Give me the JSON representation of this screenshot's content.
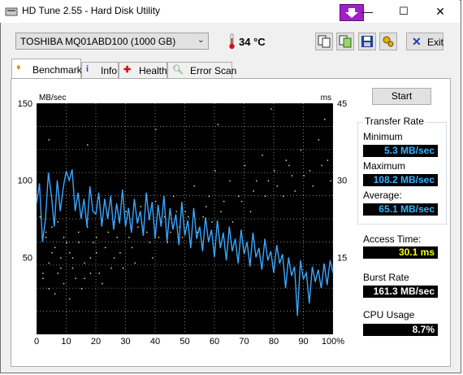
{
  "window": {
    "title": "HD Tune 2.55 - Hard Disk Utility",
    "controls": {
      "minimize": "—",
      "maximize": "☐",
      "close": "✕"
    }
  },
  "toolbar": {
    "drive": "TOSHIBA MQ01ABD100 (1000 GB)",
    "temperature": "34 °C",
    "exit_label": "Exit",
    "icons": [
      "copy-icon",
      "copy-info-icon",
      "save-icon",
      "options-icon"
    ]
  },
  "tabs": [
    {
      "label": "Benchmark",
      "icon": "benchmark-icon",
      "active": true
    },
    {
      "label": "Info",
      "icon": "info-icon",
      "active": false
    },
    {
      "label": "Health",
      "icon": "health-icon",
      "active": false
    },
    {
      "label": "Error Scan",
      "icon": "magnifier-icon",
      "active": false
    }
  ],
  "benchmark": {
    "start_label": "Start",
    "transfer_rate": {
      "group_label": "Transfer Rate",
      "minimum_label": "Minimum",
      "minimum": "5.3 MB/sec",
      "maximum_label": "Maximum",
      "maximum": "108.2 MB/sec",
      "average_label": "Average:",
      "average": "65.1 MB/sec"
    },
    "access_time_label": "Access Time:",
    "access_time": "30.1 ms",
    "burst_rate_label": "Burst Rate",
    "burst_rate": "161.3 MB/sec",
    "cpu_usage_label": "CPU Usage",
    "cpu_usage": "8.7%"
  },
  "colors": {
    "chart_bg": "#000000",
    "transfer_line": "#3aa7ff",
    "access_dots": "#ffff66",
    "grid": "#b0b0b0"
  },
  "chart_data": {
    "type": "line",
    "left_axis_unit": "MB/sec",
    "right_axis_unit": "ms",
    "left_ticks": [
      "150",
      "100",
      "50"
    ],
    "right_ticks": [
      "45",
      "30",
      "15"
    ],
    "x_ticks": [
      "0",
      "10",
      "20",
      "30",
      "40",
      "50",
      "60",
      "70",
      "80",
      "90",
      "100%"
    ],
    "xlim": [
      0,
      100
    ],
    "ylim": [
      0,
      150
    ],
    "y2lim": [
      0,
      45
    ],
    "grid": true,
    "series": [
      {
        "x": [
          0,
          1,
          2,
          3,
          4,
          5,
          6,
          7,
          8,
          9,
          10,
          11,
          12,
          13,
          14,
          15,
          16,
          17,
          18,
          19,
          20,
          21,
          22,
          23,
          24,
          25,
          26,
          27,
          28,
          29,
          30,
          31,
          32,
          33,
          34,
          35,
          36,
          37,
          38,
          39,
          40,
          41,
          42,
          43,
          44,
          45,
          46,
          47,
          48,
          49,
          50,
          51,
          52,
          53,
          54,
          55,
          56,
          57,
          58,
          59,
          60,
          61,
          62,
          63,
          64,
          65,
          66,
          67,
          68,
          69,
          70,
          71,
          72,
          73,
          74,
          75,
          76,
          77,
          78,
          79,
          80,
          81,
          82,
          83,
          84,
          85,
          86,
          87,
          88,
          89,
          90,
          91,
          92,
          93,
          94,
          95,
          96,
          97,
          98,
          99,
          100
        ],
        "values": [
          85,
          98,
          60,
          75,
          105,
          90,
          70,
          100,
          80,
          95,
          106,
          100,
          107,
          80,
          92,
          75,
          88,
          70,
          96,
          80,
          78,
          92,
          70,
          88,
          75,
          90,
          68,
          85,
          72,
          94,
          70,
          82,
          66,
          88,
          72,
          80,
          64,
          92,
          74,
          86,
          62,
          84,
          70,
          90,
          60,
          82,
          68,
          78,
          58,
          86,
          64,
          74,
          56,
          82,
          62,
          70,
          54,
          76,
          60,
          68,
          50,
          74,
          56,
          66,
          48,
          70,
          54,
          62,
          46,
          68,
          52,
          60,
          44,
          66,
          50,
          56,
          42,
          62,
          48,
          54,
          40,
          58,
          46,
          52,
          30,
          50,
          38,
          44,
          12,
          48,
          36,
          40,
          20,
          44,
          34,
          42,
          30,
          46,
          32,
          48,
          40
        ]
      }
    ],
    "access_time_series": {
      "note_units": "ms",
      "points": [
        [
          2,
          12
        ],
        [
          3,
          20
        ],
        [
          4,
          9
        ],
        [
          5,
          16
        ],
        [
          6,
          8
        ],
        [
          7,
          22
        ],
        [
          8,
          13
        ],
        [
          9,
          10
        ],
        [
          10,
          18
        ],
        [
          11,
          7
        ],
        [
          12,
          15
        ],
        [
          13,
          11
        ],
        [
          14,
          20
        ],
        [
          15,
          9
        ],
        [
          16,
          14
        ],
        [
          18,
          12
        ],
        [
          19,
          18
        ],
        [
          20,
          16
        ],
        [
          22,
          10
        ],
        [
          24,
          20
        ],
        [
          25,
          13
        ],
        [
          26,
          22
        ],
        [
          28,
          16
        ],
        [
          30,
          24
        ],
        [
          31,
          19
        ],
        [
          33,
          14
        ],
        [
          35,
          25
        ],
        [
          36,
          21
        ],
        [
          38,
          18
        ],
        [
          40,
          26
        ],
        [
          42,
          22
        ],
        [
          44,
          18
        ],
        [
          46,
          27
        ],
        [
          48,
          21
        ],
        [
          50,
          24
        ],
        [
          53,
          29
        ],
        [
          56,
          23
        ],
        [
          58,
          27
        ],
        [
          60,
          32
        ],
        [
          62,
          24
        ],
        [
          65,
          30
        ],
        [
          68,
          27
        ],
        [
          70,
          33
        ],
        [
          73,
          28
        ],
        [
          76,
          35
        ],
        [
          78,
          30
        ],
        [
          81,
          29
        ],
        [
          84,
          34
        ],
        [
          86,
          31
        ],
        [
          89,
          36
        ],
        [
          92,
          32
        ],
        [
          95,
          38
        ],
        [
          98,
          34
        ],
        [
          4,
          38
        ],
        [
          17,
          37
        ],
        [
          40,
          40
        ],
        [
          61,
          41
        ],
        [
          79,
          44
        ],
        [
          97,
          42
        ],
        [
          1,
          23
        ],
        [
          2,
          11
        ],
        [
          3,
          19
        ],
        [
          4,
          14
        ],
        [
          5,
          21
        ],
        [
          6,
          17
        ],
        [
          7,
          12
        ],
        [
          8,
          15
        ],
        [
          9,
          19
        ],
        [
          11,
          16
        ],
        [
          12,
          13
        ],
        [
          14,
          18
        ],
        [
          16,
          11
        ],
        [
          17,
          21
        ],
        [
          18,
          15
        ],
        [
          20,
          19
        ],
        [
          21,
          12
        ],
        [
          23,
          17
        ],
        [
          26,
          15
        ],
        [
          27,
          19
        ],
        [
          29,
          13
        ],
        [
          32,
          17
        ],
        [
          34,
          21
        ],
        [
          37,
          20
        ],
        [
          39,
          15
        ],
        [
          41,
          19
        ],
        [
          43,
          23
        ],
        [
          45,
          20
        ],
        [
          47,
          24
        ],
        [
          49,
          19
        ],
        [
          51,
          23
        ],
        [
          54,
          20
        ],
        [
          57,
          25
        ],
        [
          59,
          22
        ],
        [
          63,
          26
        ],
        [
          66,
          22
        ],
        [
          69,
          26
        ],
        [
          72,
          24
        ],
        [
          74,
          30
        ],
        [
          77,
          27
        ],
        [
          80,
          32
        ],
        [
          83,
          27
        ],
        [
          85,
          33
        ],
        [
          87,
          28
        ],
        [
          90,
          31
        ],
        [
          93,
          29
        ],
        [
          96,
          33
        ],
        [
          99,
          30
        ]
      ]
    }
  }
}
